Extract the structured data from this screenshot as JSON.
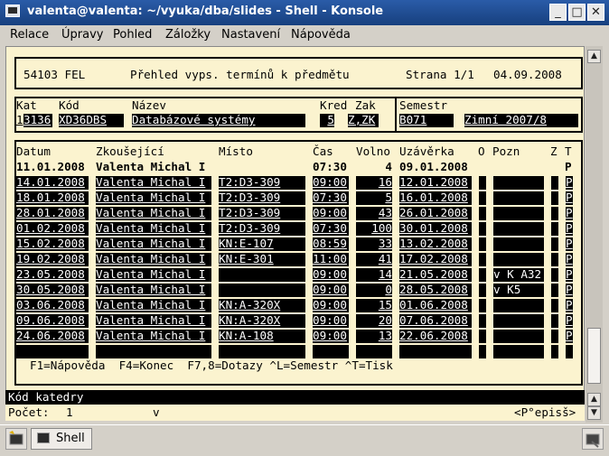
{
  "window": {
    "title": "valenta@valenta: ~/vyuka/dba/slides - Shell - Konsole"
  },
  "menu": [
    "Relace",
    "Úpravy",
    "Pohled",
    "Záložky",
    "Nastavení",
    "Nápověda"
  ],
  "screen": {
    "header": {
      "code": "54103 FEL",
      "title": "Přehled vyps. termínů k předmětu",
      "page": "Strana 1/1",
      "date": "04.09.2008"
    },
    "course": {
      "labels": {
        "kat": "Kat",
        "kod": "Kód",
        "nazev": "Název",
        "kred": "Kred",
        "zak": "Zak",
        "semestr": "Semestr"
      },
      "kat_cursor": "1",
      "kat": "3136",
      "kod": "XD36DBS",
      "nazev": "Databázové systémy",
      "kred": "5",
      "zak": "Z,ZK",
      "semestr_code": "B071",
      "semestr_name": "Zimní 2007/8"
    },
    "table": {
      "columns": [
        "Datum",
        "Zkoušející",
        "Místo",
        "Čas",
        "Volno",
        "Uzávěrka",
        "O",
        "Pozn",
        "Z",
        "T"
      ],
      "current": {
        "datum": "11.01.2008",
        "zkousejici": "Valenta Michal I",
        "misto": "",
        "cas": "07:30",
        "volno": "4",
        "uzaverka": "09.01.2008",
        "o": "",
        "pozn": "",
        "z": "",
        "t": "P"
      },
      "rows": [
        {
          "datum": "14.01.2008",
          "zkousejici": "Valenta Michal I",
          "misto": "T2:D3-309",
          "cas": "09:00",
          "volno": "16",
          "uzaverka": "12.01.2008",
          "o": "",
          "pozn": "",
          "z": "",
          "t": "P"
        },
        {
          "datum": "18.01.2008",
          "zkousejici": "Valenta Michal I",
          "misto": "T2:D3-309",
          "cas": "07:30",
          "volno": "5",
          "uzaverka": "16.01.2008",
          "o": "",
          "pozn": "",
          "z": "",
          "t": "P"
        },
        {
          "datum": "28.01.2008",
          "zkousejici": "Valenta Michal I",
          "misto": "T2:D3-309",
          "cas": "09:00",
          "volno": "43",
          "uzaverka": "26.01.2008",
          "o": "",
          "pozn": "",
          "z": "",
          "t": "P"
        },
        {
          "datum": "01.02.2008",
          "zkousejici": "Valenta Michal I",
          "misto": "T2:D3-309",
          "cas": "07:30",
          "volno": "100",
          "uzaverka": "30.01.2008",
          "o": "",
          "pozn": "",
          "z": "",
          "t": "P"
        },
        {
          "datum": "15.02.2008",
          "zkousejici": "Valenta Michal I",
          "misto": "KN:E-107",
          "cas": "08:59",
          "volno": "33",
          "uzaverka": "13.02.2008",
          "o": "",
          "pozn": "",
          "z": "",
          "t": "P"
        },
        {
          "datum": "19.02.2008",
          "zkousejici": "Valenta Michal I",
          "misto": "KN:E-301",
          "cas": "11:00",
          "volno": "41",
          "uzaverka": "17.02.2008",
          "o": "",
          "pozn": "",
          "z": "",
          "t": "P"
        },
        {
          "datum": "23.05.2008",
          "zkousejici": "Valenta Michal I",
          "misto": "",
          "cas": "09:00",
          "volno": "14",
          "uzaverka": "21.05.2008",
          "o": "",
          "pozn": "v K A32",
          "z": "",
          "t": "P"
        },
        {
          "datum": "30.05.2008",
          "zkousejici": "Valenta Michal I",
          "misto": "",
          "cas": "09:00",
          "volno": "0",
          "uzaverka": "28.05.2008",
          "o": "",
          "pozn": "v K5",
          "z": "",
          "t": "P"
        },
        {
          "datum": "03.06.2008",
          "zkousejici": "Valenta Michal I",
          "misto": "KN:A-320X",
          "cas": "09:00",
          "volno": "15",
          "uzaverka": "01.06.2008",
          "o": "",
          "pozn": "",
          "z": "",
          "t": "P"
        },
        {
          "datum": "09.06.2008",
          "zkousejici": "Valenta Michal I",
          "misto": "KN:A-320X",
          "cas": "09:00",
          "volno": "20",
          "uzaverka": "07.06.2008",
          "o": "",
          "pozn": "",
          "z": "",
          "t": "P"
        },
        {
          "datum": "24.06.2008",
          "zkousejici": "Valenta Michal I",
          "misto": "KN:A-108",
          "cas": "09:00",
          "volno": "13",
          "uzaverka": "22.06.2008",
          "o": "",
          "pozn": "",
          "z": "",
          "t": "P"
        }
      ]
    },
    "footer_keys": "F1=Nápověda  F4=Konec  F7,8=Dotazy ^L=Semestr ^T=Tisk"
  },
  "status": {
    "field_hint": "Kód katedry",
    "count_label": "Počet:",
    "count_value": "1",
    "flag": "v",
    "mode": "<P°episš>"
  },
  "taskbar": {
    "tab_label": "Shell"
  }
}
